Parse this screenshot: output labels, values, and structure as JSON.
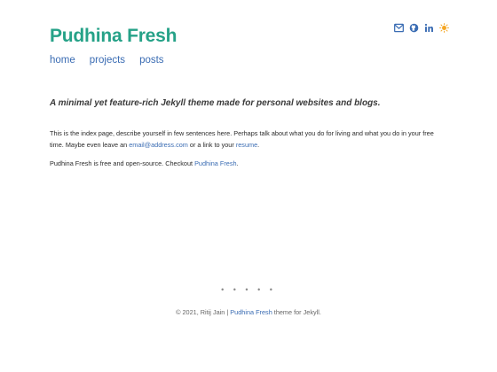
{
  "header": {
    "site_title": "Pudhina Fresh",
    "nav": [
      {
        "label": "home"
      },
      {
        "label": "projects"
      },
      {
        "label": "posts"
      }
    ],
    "social_icons": [
      "email-icon",
      "github-icon",
      "linkedin-icon",
      "theme-toggle-sun-icon"
    ]
  },
  "main": {
    "tagline": "A minimal yet feature-rich Jekyll theme made for personal websites and blogs.",
    "para1_text": "This is the index page, describe yourself in few sentences here. Perhaps talk about what you do for living and what you do in your free time. Maybe even leave an ",
    "para1_email": "email@address.com",
    "para1_mid": " or a link to your ",
    "para1_resume": "resume",
    "para1_end": ".",
    "para2_text": "Pudhina Fresh is free and open-source. Checkout ",
    "para2_link": "Pudhina Fresh",
    "para2_end": "."
  },
  "footer": {
    "dots": "• • • • •",
    "copyright": "© 2021, Ritij Jain | ",
    "theme_link": "Pudhina Fresh",
    "suffix": " theme for Jekyll."
  },
  "colors": {
    "accent": "#26a288",
    "link": "#3a6cb3",
    "icon": "#3a6cb3",
    "sun": "#f5a623"
  }
}
